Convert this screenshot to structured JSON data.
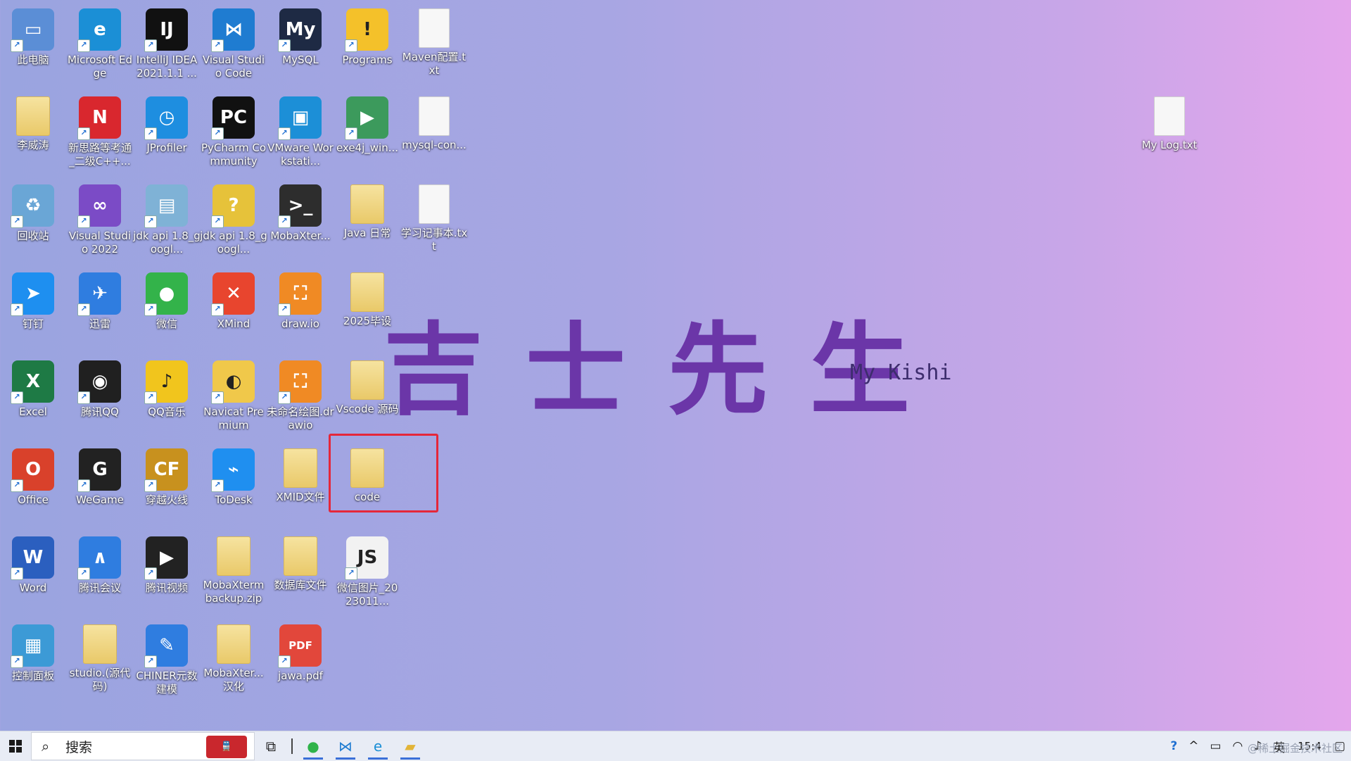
{
  "desktop": {
    "watermark_title": "吉士先生",
    "watermark_subtitle": "My Kishi",
    "icons": [
      {
        "label": "此电脑",
        "symbol": "▭",
        "color": "#5b8ed6"
      },
      {
        "label": "Microsoft Edge",
        "symbol": "e",
        "color": "#1b8fd6"
      },
      {
        "label": "IntelliJ IDEA 2021.1.1 ...",
        "symbol": "IJ",
        "color": "#111111"
      },
      {
        "label": "Visual Studio Code",
        "symbol": "⋈",
        "color": "#1f7cd1"
      },
      {
        "label": "MySQL",
        "symbol": "My",
        "color": "#1e2a44"
      },
      {
        "label": "Programs",
        "symbol": "!",
        "color": "#f4c12a"
      },
      {
        "label": "Maven配置.txt",
        "symbol": "",
        "color": "doc"
      },
      {
        "label": "李威涛",
        "symbol": "",
        "color": "folder"
      },
      {
        "label": "新思路等考通_二级C++...",
        "symbol": "N",
        "color": "#d9272e"
      },
      {
        "label": "JProfiler",
        "symbol": "◷",
        "color": "#1e8ee0"
      },
      {
        "label": "PyCharm Community",
        "symbol": "PC",
        "color": "#111111"
      },
      {
        "label": "VMware Workstati...",
        "symbol": "▣",
        "color": "#1c8fd7"
      },
      {
        "label": "exe4j_win...",
        "symbol": "▶",
        "color": "#3c9a5c"
      },
      {
        "label": "mysql-con...",
        "symbol": "",
        "color": "doc"
      },
      {
        "label": "回收站",
        "symbol": "♻",
        "color": "#6aa6d6"
      },
      {
        "label": "Visual Studio 2022",
        "symbol": "∞",
        "color": "#7b4bc6"
      },
      {
        "label": "jdk api 1.8_googl...",
        "symbol": "▤",
        "color": "#7fb2d6"
      },
      {
        "label": "jdk api 1.8_googl...",
        "symbol": "?",
        "color": "#e6c23a"
      },
      {
        "label": "MobaXter...",
        "symbol": ">_",
        "color": "#2d2d2d"
      },
      {
        "label": "Java 日常",
        "symbol": "",
        "color": "folder"
      },
      {
        "label": "学习记事本.txt",
        "symbol": "",
        "color": "doc"
      },
      {
        "label": "钉钉",
        "symbol": "➤",
        "color": "#1e8ff0"
      },
      {
        "label": "迅雷",
        "symbol": "✈",
        "color": "#2f7de0"
      },
      {
        "label": "微信",
        "symbol": "●",
        "color": "#33b34a"
      },
      {
        "label": "XMind",
        "symbol": "✕",
        "color": "#e8452e"
      },
      {
        "label": "draw.io",
        "symbol": "⛶",
        "color": "#f08a24"
      },
      {
        "label": "2025毕设",
        "symbol": "",
        "color": "folder"
      },
      {
        "label": "Excel",
        "symbol": "X",
        "color": "#1e7a45"
      },
      {
        "label": "腾讯QQ",
        "symbol": "◉",
        "color": "#202020"
      },
      {
        "label": "QQ音乐",
        "symbol": "♪",
        "color": "#f1c51d"
      },
      {
        "label": "Navicat Premium",
        "symbol": "◐",
        "color": "#f0c84a"
      },
      {
        "label": "未命名绘图.drawio",
        "symbol": "⛶",
        "color": "#f08a24"
      },
      {
        "label": "Vscode 源码",
        "symbol": "",
        "color": "folder"
      },
      {
        "label": "Office",
        "symbol": "O",
        "color": "#d9412b"
      },
      {
        "label": "WeGame",
        "symbol": "G",
        "color": "#222222"
      },
      {
        "label": "穿越火线",
        "symbol": "CF",
        "color": "#c8911e"
      },
      {
        "label": "ToDesk",
        "symbol": "⌁",
        "color": "#1f8ff0"
      },
      {
        "label": "XMID文件",
        "symbol": "",
        "color": "folder"
      },
      {
        "label": "code",
        "symbol": "",
        "color": "folder"
      },
      {
        "label": "Word",
        "symbol": "W",
        "color": "#2b5fbf"
      },
      {
        "label": "腾讯会议",
        "symbol": "∧",
        "color": "#2f7de0"
      },
      {
        "label": "腾讯视频",
        "symbol": "▶",
        "color": "#222222"
      },
      {
        "label": "MobaXterm backup.zip",
        "symbol": "",
        "color": "folder"
      },
      {
        "label": "数据库文件",
        "symbol": "",
        "color": "folder"
      },
      {
        "label": "微信图片_2023011...",
        "symbol": "JS",
        "color": "#f2f2f2"
      },
      {
        "label": "控制面板",
        "symbol": "▦",
        "color": "#3c9ad6"
      },
      {
        "label": "studio.(源代码)",
        "symbol": "",
        "color": "folder"
      },
      {
        "label": "CHINER元数建模",
        "symbol": "✎",
        "color": "#2f7de0"
      },
      {
        "label": "MobaXter...汉化",
        "symbol": "",
        "color": "folder"
      },
      {
        "label": "jawa.pdf",
        "symbol": "PDF",
        "color": "#e2473b"
      },
      {
        "label": "My Log.txt",
        "symbol": "",
        "color": "doc"
      }
    ]
  },
  "taskbar": {
    "search_placeholder": "搜索",
    "search_art_label": "",
    "task_view_icon": "task-view-icon",
    "pinned": [
      "wechat-icon",
      "vscode-icon",
      "edge-icon",
      "file-explorer-icon"
    ],
    "tray": {
      "help": "?",
      "chevron": "^",
      "battery": "▭",
      "wifi": "◠",
      "volume": "♪",
      "lang": "英",
      "clock": "15:4",
      "notification": "▢"
    }
  },
  "corner_watermark": "@稀土掘金技术社区"
}
